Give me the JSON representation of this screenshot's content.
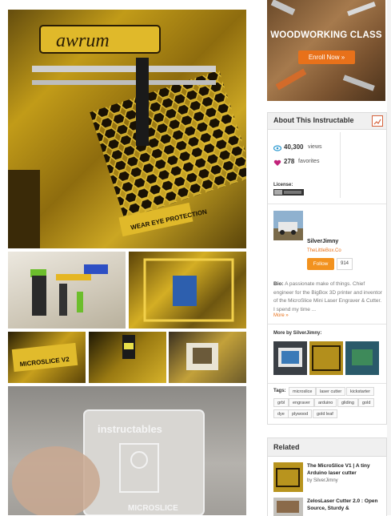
{
  "ad": {
    "title": "WOODWORKING CLASS",
    "button": "Enroll Now »"
  },
  "photos": {
    "main_caption": "WEAR EYE PROTECTION",
    "f_text1": "instructables",
    "f_text2": "MICROSLICE"
  },
  "about": {
    "title": "About This Instructable",
    "views_count": "40,300",
    "views_label": "views",
    "favorites_count": "278",
    "favorites_label": "favorites",
    "license_label": "License:",
    "author": "SilverJimny",
    "author_site": "TheLittleBox.Co",
    "follow_label": "Follow",
    "followers": "914",
    "bio_label": "Bio:",
    "bio_text": "A passionate make of things. Chief engineer for the BigBox 3D printer and inventor of the MicroSlice Mini Laser Engraver & Cutter. I spend my time ...",
    "more_link": "More »",
    "more_by": "More by SilverJimny:",
    "tags_label": "Tags:",
    "tags": [
      "microslice",
      "laser cutter",
      "kickstarter",
      "grbl",
      "engraver",
      "arduino",
      "gliding",
      "gold",
      "dye",
      "plywood",
      "gold leaf"
    ]
  },
  "related": {
    "title": "Related",
    "items": [
      {
        "title": "The MicroSlice V1 | A tiny Arduino laser cutter",
        "by": "by SilverJimny"
      },
      {
        "title": "ZelosLaser Cutter 2.0 : Open Source, Sturdy &",
        "by": ""
      }
    ]
  },
  "colors": {
    "accent": "#e8711a",
    "link": "#e8711a",
    "views_icon": "#2e9ad0",
    "fav_icon": "#c2227a"
  }
}
